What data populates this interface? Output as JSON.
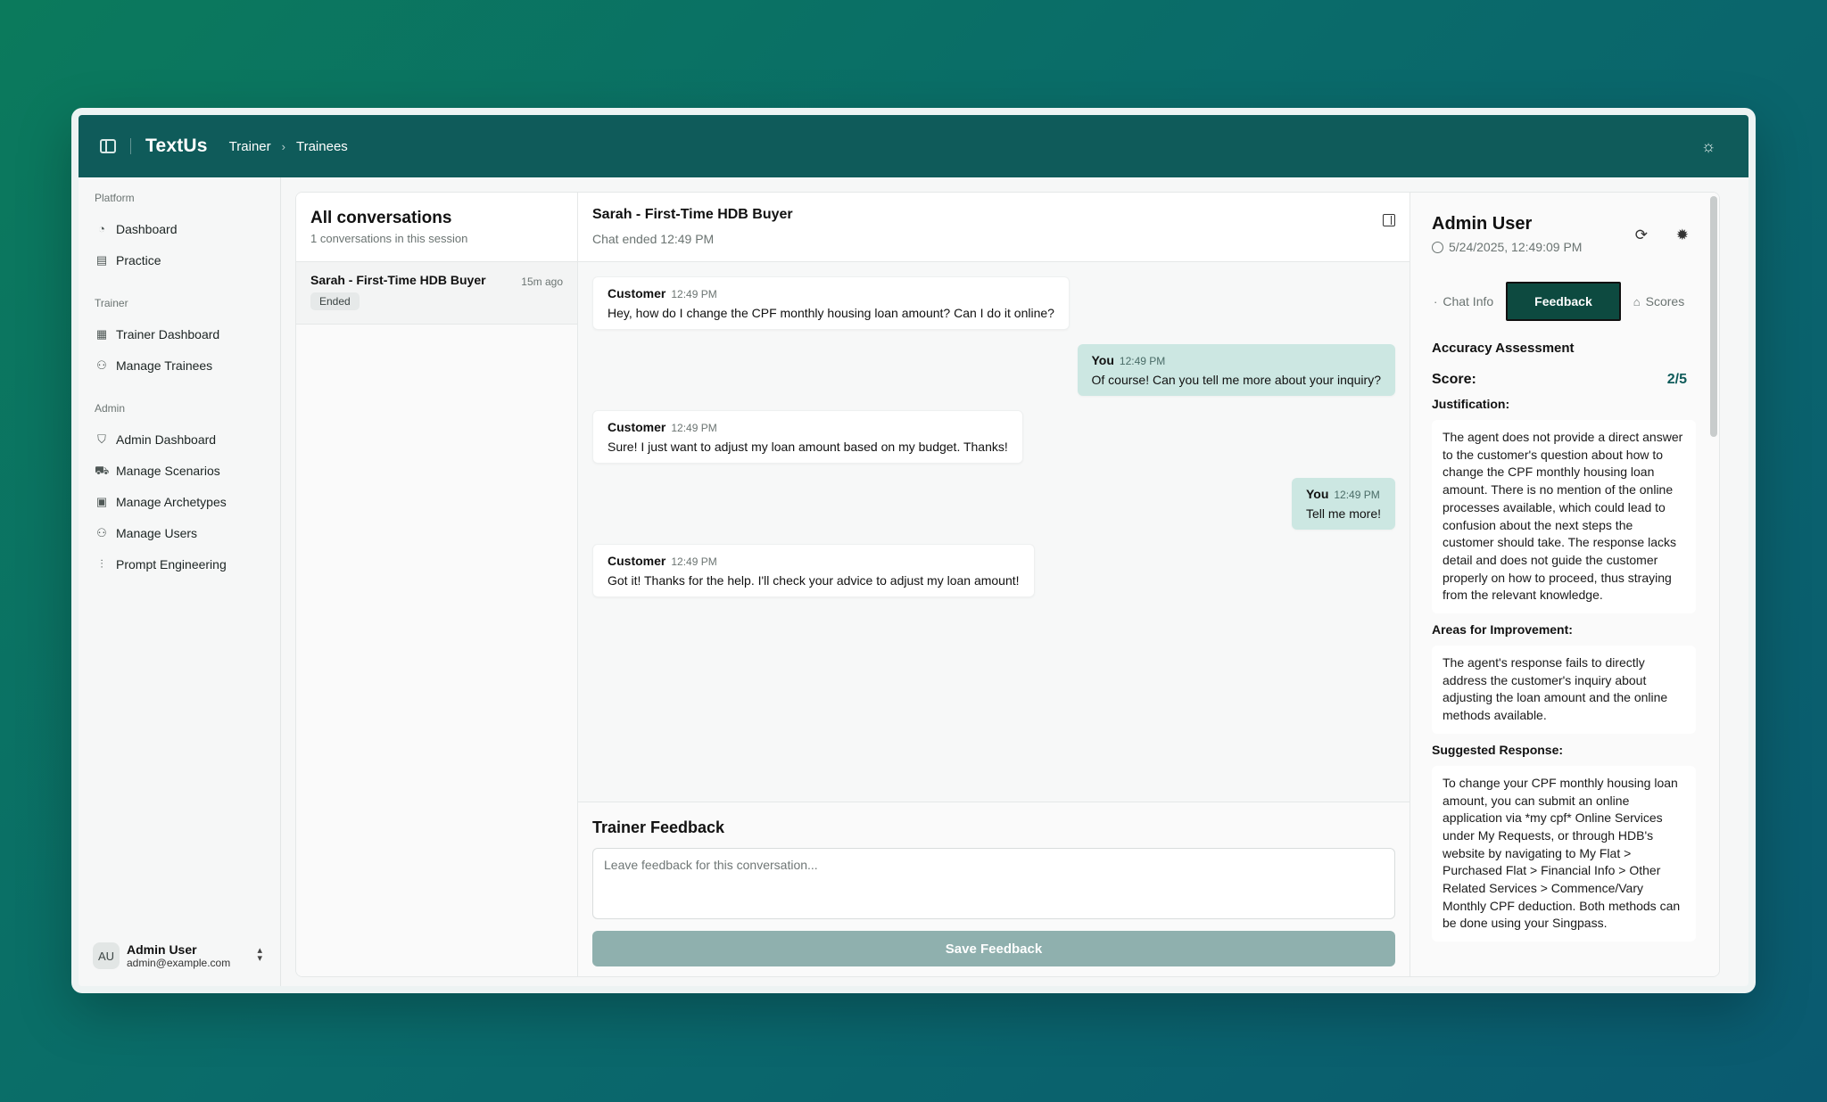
{
  "app": {
    "title": "TextUs"
  },
  "breadcrumb": [
    "Trainer",
    "Trainees"
  ],
  "sidebar": {
    "groups": [
      {
        "label": "Platform",
        "items": [
          {
            "label": "Dashboard",
            "icon": "pie-chart-icon"
          },
          {
            "label": "Practice",
            "icon": "clipboard-icon"
          }
        ]
      },
      {
        "label": "Trainer",
        "items": [
          {
            "label": "Trainer Dashboard",
            "icon": "grid-icon"
          },
          {
            "label": "Manage Trainees",
            "icon": "users-icon"
          }
        ]
      },
      {
        "label": "Admin",
        "items": [
          {
            "label": "Admin Dashboard",
            "icon": "shield-icon"
          },
          {
            "label": "Manage Scenarios",
            "icon": "scenario-icon"
          },
          {
            "label": "Manage Archetypes",
            "icon": "contact-icon"
          },
          {
            "label": "Manage Users",
            "icon": "users-icon"
          },
          {
            "label": "Prompt Engineering",
            "icon": "sliders-icon"
          }
        ]
      }
    ],
    "user": {
      "initials": "AU",
      "name": "Admin User",
      "email": "admin@example.com"
    }
  },
  "conversations": {
    "title": "All conversations",
    "subtitle": "1 conversations in this session",
    "items": [
      {
        "title": "Sarah - First-Time HDB Buyer",
        "ago": "15m ago",
        "status": "Ended"
      }
    ]
  },
  "chat": {
    "title": "Sarah - First-Time HDB Buyer",
    "status": "Chat ended  12:49 PM",
    "messages": [
      {
        "who": "Customer",
        "time": "12:49 PM",
        "text": "Hey, how do I change the CPF monthly housing loan amount? Can I do it online?"
      },
      {
        "who": "You",
        "time": "12:49 PM",
        "text": "Of course! Can you tell me more about your inquiry?"
      },
      {
        "who": "Customer",
        "time": "12:49 PM",
        "text": "Sure! I just want to adjust my loan amount based on my budget. Thanks!"
      },
      {
        "who": "You",
        "time": "12:49 PM",
        "text": "Tell me more!"
      },
      {
        "who": "Customer",
        "time": "12:49 PM",
        "text": "Got it! Thanks for the help. I'll check your advice to adjust my loan amount!"
      }
    ]
  },
  "feedback": {
    "title": "Trainer Feedback",
    "placeholder": "Leave feedback for this conversation...",
    "save_label": "Save Feedback"
  },
  "details": {
    "user": "Admin User",
    "date": "5/24/2025, 12:49:09 PM",
    "tabs": [
      {
        "label": "Chat Info"
      },
      {
        "label": "Feedback"
      },
      {
        "label": "Scores"
      }
    ],
    "active_tab": "Feedback",
    "section_title": "Accuracy Assessment",
    "score_label": "Score:",
    "score_value": "2/5",
    "justification_label": "Justification:",
    "justification": "The agent does not provide a direct answer to the customer's question about how to change the CPF monthly housing loan amount. There is no mention of the online processes available, which could lead to confusion about the next steps the customer should take. The response lacks detail and does not guide the customer properly on how to proceed, thus straying from the relevant knowledge.",
    "improvement_label": "Areas for Improvement:",
    "improvement": "The agent's response fails to directly address the customer's inquiry about adjusting the loan amount and the online methods available.",
    "suggested_label": "Suggested Response:",
    "suggested": "To change your CPF monthly housing loan amount, you can submit an online application via *my cpf* Online Services under My Requests, or through HDB's website by navigating to My Flat > Purchased Flat > Financial Info > Other Related Services > Commence/Vary Monthly CPF deduction. Both methods can be done using your Singpass."
  },
  "colors": {
    "topbar": "#0f5b5a",
    "accent": "#0d4a40",
    "you_bubble": "#cce7e2",
    "save_button": "#8fb0ae"
  }
}
